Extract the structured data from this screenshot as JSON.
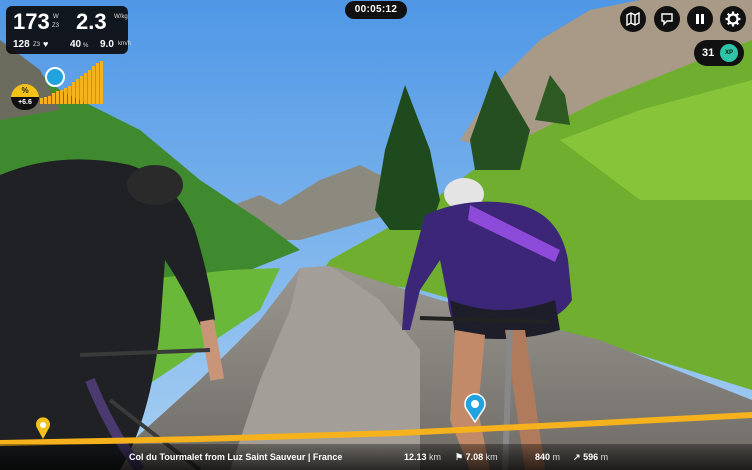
{
  "stats": {
    "power": "173",
    "power_unit": "W",
    "power_zone": "Z3",
    "wkg": "2.3",
    "wkg_unit": "W/kg",
    "heart_rate": "128",
    "hr_zone": "Z3",
    "cadence": "40",
    "cadence_unit": "%",
    "speed": "9.0",
    "speed_unit": "km/h"
  },
  "grade": {
    "symbol": "%",
    "value": "+6.6"
  },
  "timer": "00:05:12",
  "controls": {
    "map_icon": "map-icon",
    "chat_icon": "chat-icon",
    "pause_icon": "pause-icon",
    "settings_icon": "gear-icon"
  },
  "level": {
    "number": "31",
    "badge": "XP"
  },
  "footer": {
    "route_name": "Col du Tourmalet from Luz Saint Sauveur | France",
    "distance_value": "12.13",
    "distance_unit": "km",
    "remaining_value": "7.08",
    "remaining_unit": "km",
    "elevation_value": "840",
    "elevation_unit": "m",
    "ascent_value": "596",
    "ascent_unit": "m"
  },
  "colors": {
    "progress": "#f5b21c",
    "accent": "#2ec4a8",
    "marker_blue": "#22a3e0",
    "panel": "#111111"
  }
}
